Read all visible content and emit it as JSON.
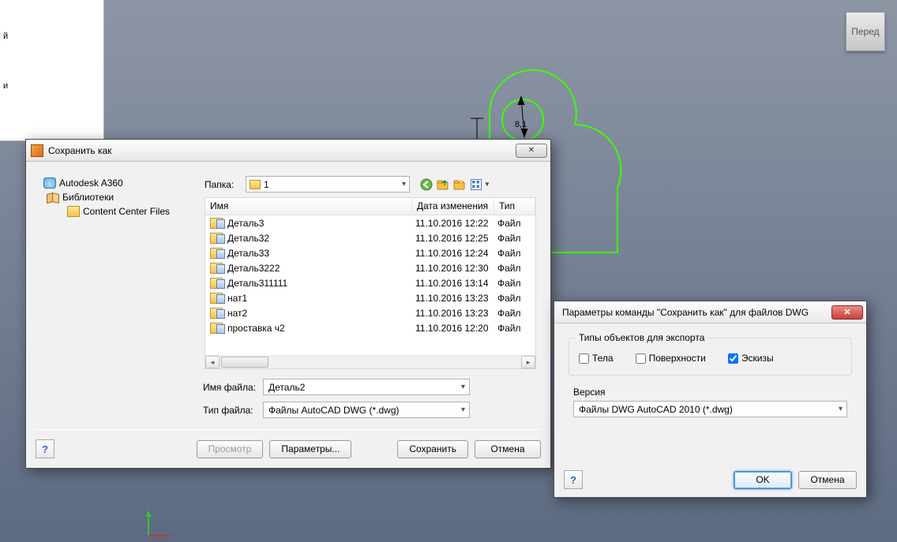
{
  "viewcube": {
    "label": "Перед"
  },
  "left_panel": {
    "line1": "й",
    "line2": "и"
  },
  "dimension": {
    "value": "8,1"
  },
  "save_dialog": {
    "title": "Сохранить как",
    "tree": {
      "item1": "Autodesk A360",
      "item2": "Библиотеки",
      "item3": "Content Center Files"
    },
    "folder_label": "Папка:",
    "folder_value": "1",
    "columns": {
      "name": "Имя",
      "date": "Дата изменения",
      "type": "Тип"
    },
    "files": [
      {
        "name": "Деталь3",
        "date": "11.10.2016 12:22",
        "type": "Файл"
      },
      {
        "name": "Деталь32",
        "date": "11.10.2016 12:25",
        "type": "Файл"
      },
      {
        "name": "Деталь33",
        "date": "11.10.2016 12:24",
        "type": "Файл"
      },
      {
        "name": "Деталь3222",
        "date": "11.10.2016 12:30",
        "type": "Файл"
      },
      {
        "name": "Деталь311111",
        "date": "11.10.2016 13:14",
        "type": "Файл"
      },
      {
        "name": "нат1",
        "date": "11.10.2016 13:23",
        "type": "Файл"
      },
      {
        "name": "нат2",
        "date": "11.10.2016 13:23",
        "type": "Файл"
      },
      {
        "name": "проставка ч2",
        "date": "11.10.2016 12:20",
        "type": "Файл"
      }
    ],
    "filename_label": "Имя файла:",
    "filename_value": "Деталь2",
    "filetype_label": "Тип файла:",
    "filetype_value": "Файлы AutoCAD DWG (*.dwg)",
    "buttons": {
      "preview": "Просмотр",
      "options": "Параметры...",
      "save": "Сохранить",
      "cancel": "Отмена"
    }
  },
  "options_dialog": {
    "title": "Параметры команды \"Сохранить как\" для файлов DWG",
    "group_title": "Типы объектов для экспорта",
    "cb_bodies": "Тела",
    "cb_surfaces": "Поверхности",
    "cb_sketches": "Эскизы",
    "cb_bodies_checked": false,
    "cb_surfaces_checked": false,
    "cb_sketches_checked": true,
    "version_label": "Версия",
    "version_value": "Файлы DWG AutoCAD 2010 (*.dwg)",
    "buttons": {
      "ok": "OK",
      "cancel": "Отмена"
    }
  }
}
